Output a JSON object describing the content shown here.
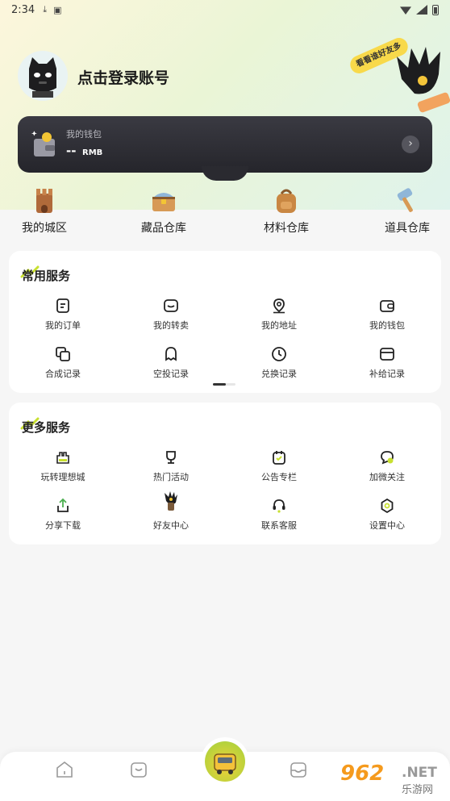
{
  "status_bar": {
    "time": "2:34"
  },
  "header": {
    "login_text": "点击登录账号",
    "promo_tag": "看看谁好友多"
  },
  "wallet": {
    "label": "我的钱包",
    "amount": "--",
    "unit": "RMB"
  },
  "storage": [
    {
      "label": "我的城区",
      "icon": "castle-icon"
    },
    {
      "label": "藏品仓库",
      "icon": "treasure-chest-icon"
    },
    {
      "label": "材料仓库",
      "icon": "backpack-icon"
    },
    {
      "label": "道具仓库",
      "icon": "hammer-icon"
    }
  ],
  "common_services": {
    "title": "常用服务",
    "items": [
      {
        "label": "我的订单",
        "icon": "order-icon"
      },
      {
        "label": "我的转卖",
        "icon": "resale-icon"
      },
      {
        "label": "我的地址",
        "icon": "location-icon"
      },
      {
        "label": "我的钱包",
        "icon": "wallet-icon"
      },
      {
        "label": "合成记录",
        "icon": "compose-icon"
      },
      {
        "label": "空投记录",
        "icon": "airdrop-icon"
      },
      {
        "label": "兑换记录",
        "icon": "clock-icon"
      },
      {
        "label": "补给记录",
        "icon": "supply-icon"
      }
    ]
  },
  "more_services": {
    "title": "更多服务",
    "items": [
      {
        "label": "玩转理想城",
        "icon": "city-icon"
      },
      {
        "label": "热门活动",
        "icon": "trophy-icon"
      },
      {
        "label": "公告专栏",
        "icon": "notice-icon"
      },
      {
        "label": "加微关注",
        "icon": "wechat-icon"
      },
      {
        "label": "分享下载",
        "icon": "share-icon"
      },
      {
        "label": "好友中心",
        "icon": "friends-icon"
      },
      {
        "label": "联系客服",
        "icon": "headset-icon"
      },
      {
        "label": "设置中心",
        "icon": "settings-icon"
      }
    ]
  },
  "watermark": {
    "number": "962",
    "net": ".NET",
    "site": "乐游网"
  },
  "colors": {
    "accent": "#c8e030",
    "wallet_bg": "#2a2a30",
    "page_bg": "#f6f6f6"
  }
}
